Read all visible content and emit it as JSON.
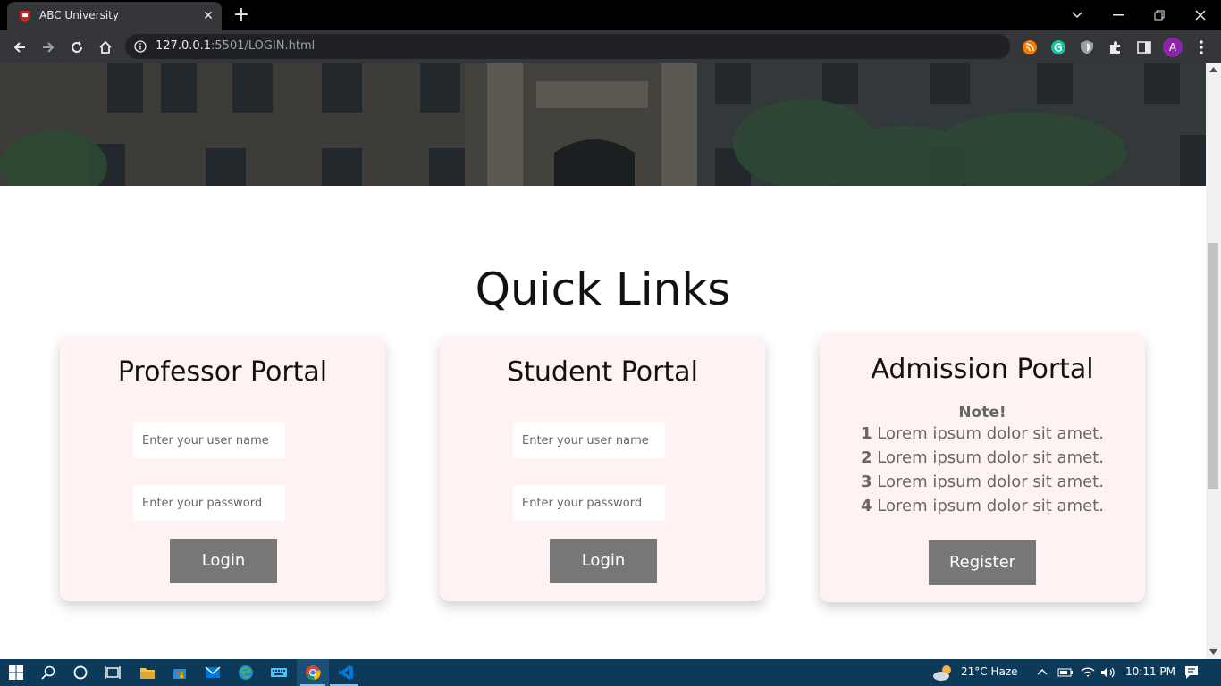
{
  "browser": {
    "tab_title": "ABC University",
    "url_host": "127.0.0.1",
    "url_rest": ":5501/LOGIN.html",
    "profile_initial": "A"
  },
  "page": {
    "section_title": "Quick Links",
    "professor": {
      "title": "Professor Portal",
      "username_placeholder": "Enter your user name",
      "password_placeholder": "Enter your password",
      "login_label": "Login"
    },
    "student": {
      "title": "Student Portal",
      "username_placeholder": "Enter your user name",
      "password_placeholder": "Enter your password",
      "login_label": "Login"
    },
    "admission": {
      "title": "Admission Portal",
      "note_heading": "Note!",
      "notes": [
        {
          "num": "1",
          "text": "Lorem ipsum dolor sit amet."
        },
        {
          "num": "2",
          "text": "Lorem ipsum dolor sit amet."
        },
        {
          "num": "3",
          "text": "Lorem ipsum dolor sit amet."
        },
        {
          "num": "4",
          "text": "Lorem ipsum dolor sit amet."
        }
      ],
      "register_label": "Register"
    }
  },
  "taskbar": {
    "weather": "21°C  Haze",
    "time": "10:11 PM"
  },
  "colors": {
    "card_bg": "#fff2f2",
    "button_bg": "#777777",
    "taskbar_bg": "#0e3a5a"
  }
}
